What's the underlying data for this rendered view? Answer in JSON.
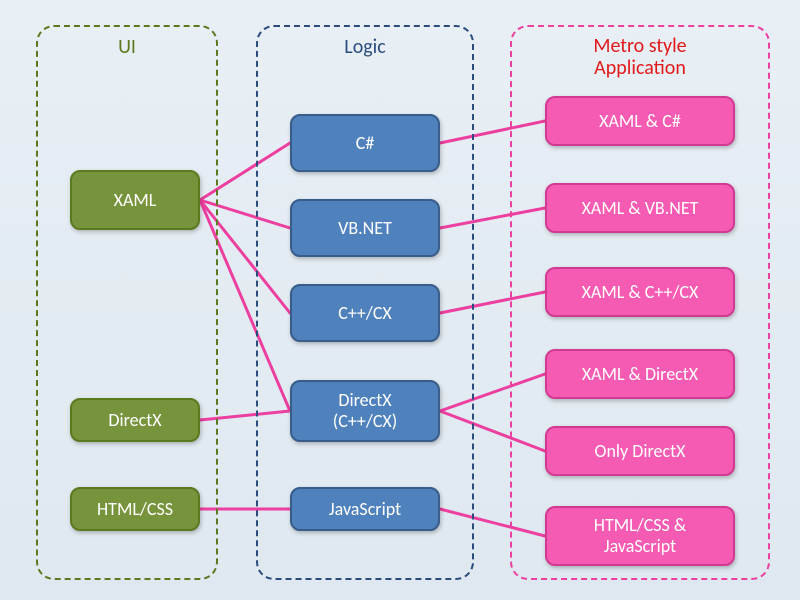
{
  "columns": {
    "ui": {
      "title": "UI"
    },
    "logic": {
      "title": "Logic"
    },
    "metro": {
      "title": "Metro style\nApplication"
    }
  },
  "ui_nodes": {
    "xaml": "XAML",
    "directx": "DirectX",
    "htmlcss": "HTML/CSS"
  },
  "logic_nodes": {
    "csharp": "C#",
    "vbnet": "VB.NET",
    "cppcx": "C++/CX",
    "dx": "DirectX\n(C++/CX)",
    "js": "JavaScript"
  },
  "metro_nodes": {
    "xaml_cs": "XAML & C#",
    "xaml_vb": "XAML & VB.NET",
    "xaml_cpp": "XAML & C++/CX",
    "xaml_dx": "XAML & DirectX",
    "only_dx": "Only DirectX",
    "html_js": "HTML/CSS &\nJavaScript"
  },
  "colors": {
    "ui_border": "#5b7a1f",
    "logic_border": "#2a4c7d",
    "metro_border": "#ec3fa0",
    "metro_title": "#e11919",
    "ui_fill": "#77933c",
    "logic_fill": "#4f81bd",
    "metro_fill": "#f55bb2",
    "connector": "#ec3fa0"
  }
}
